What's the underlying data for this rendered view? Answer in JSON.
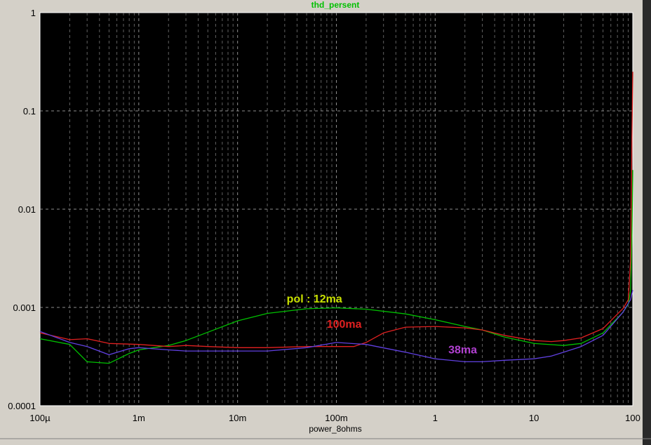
{
  "chart_data": {
    "type": "line",
    "title": "thd_persent",
    "xlabel": "power_8ohms",
    "ylabel": "",
    "x_scale": "log",
    "y_scale": "log",
    "xlim": [
      0.0001,
      100
    ],
    "ylim": [
      0.0001,
      1
    ],
    "grid": true,
    "x_tick_labels": [
      "100µ",
      "1m",
      "10m",
      "100m",
      "1",
      "10",
      "100"
    ],
    "x_tick_values": [
      0.0001,
      0.001,
      0.01,
      0.1,
      1,
      10,
      100
    ],
    "y_tick_labels": [
      "1",
      "0.1",
      "0.01",
      "0.001",
      "0.0001"
    ],
    "y_tick_values": [
      1,
      0.1,
      0.01,
      0.001,
      0.0001
    ],
    "colors": {
      "background": "#000000",
      "grid": "#b0b0b0",
      "frame": "#d4d0c8",
      "title": "#00c000"
    },
    "annotations": [
      {
        "text": "pol : 12ma",
        "color": "#c8e000",
        "x": 0.06,
        "y": 0.00112
      },
      {
        "text": "100ma",
        "color": "#e02020",
        "x": 0.12,
        "y": 0.00062
      },
      {
        "text": "38ma",
        "color": "#b040d0",
        "x": 1.9,
        "y": 0.00034
      }
    ],
    "series": [
      {
        "color": "#00c000",
        "x": [
          0.0001,
          0.0002,
          0.0003,
          0.0005,
          0.0008,
          0.001,
          0.002,
          0.003,
          0.005,
          0.01,
          0.02,
          0.05,
          0.1,
          0.2,
          0.5,
          1,
          2,
          3,
          5,
          10,
          20,
          30,
          50,
          80,
          90,
          95,
          98,
          100
        ],
        "y": [
          0.00048,
          0.00042,
          0.00028,
          0.00027,
          0.00034,
          0.00037,
          0.00041,
          0.00046,
          0.00056,
          0.00073,
          0.00087,
          0.00097,
          0.00099,
          0.00096,
          0.00086,
          0.00075,
          0.00064,
          0.00059,
          0.0005,
          0.00043,
          0.00041,
          0.00043,
          0.00055,
          0.0009,
          0.00108,
          0.0015,
          0.005,
          0.025
        ]
      },
      {
        "color": "#e02020",
        "x": [
          0.0001,
          0.0002,
          0.0003,
          0.0005,
          0.001,
          0.002,
          0.003,
          0.005,
          0.01,
          0.02,
          0.05,
          0.1,
          0.15,
          0.2,
          0.3,
          0.5,
          1,
          2,
          3,
          5,
          10,
          15,
          20,
          30,
          50,
          80,
          90,
          95,
          98,
          100
        ],
        "y": [
          0.00055,
          0.00047,
          0.00048,
          0.00043,
          0.00042,
          0.0004,
          0.00041,
          0.0004,
          0.00039,
          0.00039,
          0.0004,
          0.0004,
          0.0004,
          0.00044,
          0.00055,
          0.00063,
          0.00064,
          0.00062,
          0.00059,
          0.00052,
          0.00046,
          0.00045,
          0.00046,
          0.00049,
          0.00061,
          0.00098,
          0.0012,
          0.003,
          0.05,
          0.25
        ]
      },
      {
        "color": "#6040e0",
        "x": [
          0.0001,
          0.0002,
          0.0003,
          0.0005,
          0.0008,
          0.001,
          0.002,
          0.003,
          0.005,
          0.01,
          0.02,
          0.05,
          0.1,
          0.2,
          0.5,
          1,
          2,
          3,
          5,
          10,
          15,
          20,
          30,
          50,
          80,
          90,
          95,
          100
        ],
        "y": [
          0.00057,
          0.00044,
          0.0004,
          0.00033,
          0.00038,
          0.00039,
          0.00037,
          0.00036,
          0.00036,
          0.00036,
          0.00036,
          0.00039,
          0.00044,
          0.00042,
          0.00035,
          0.0003,
          0.00028,
          0.00028,
          0.00029,
          0.0003,
          0.00032,
          0.00035,
          0.0004,
          0.00052,
          0.0009,
          0.0011,
          0.0012,
          0.0015
        ]
      }
    ]
  }
}
